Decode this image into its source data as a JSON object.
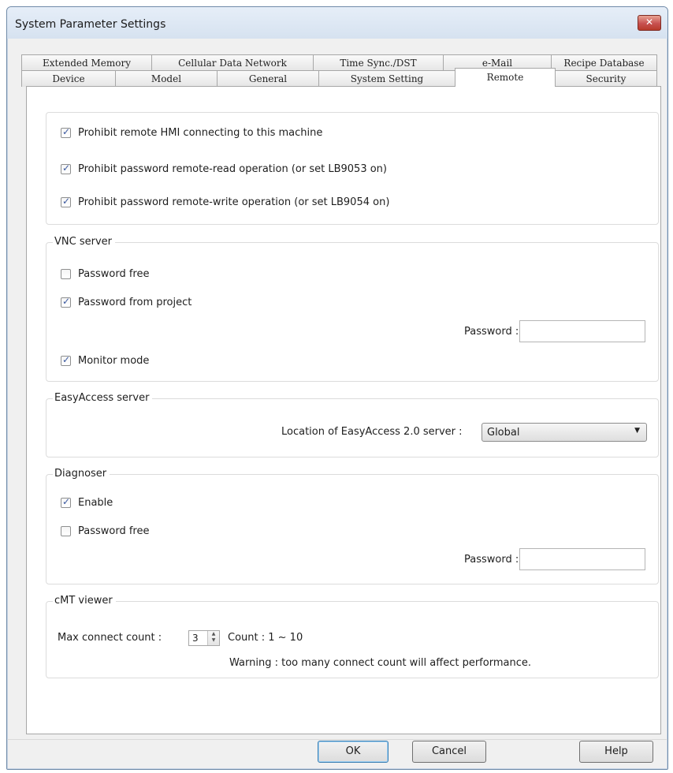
{
  "window": {
    "title": "System Parameter Settings",
    "close_glyph": "✕"
  },
  "tabs": {
    "row1": [
      "Extended Memory",
      "Cellular Data Network",
      "Time Sync./DST",
      "e-Mail",
      "Recipe Database"
    ],
    "row2": [
      "Device",
      "Model",
      "General",
      "System Setting",
      "Remote",
      "Security"
    ],
    "active": "Remote"
  },
  "remote_group": {
    "items": [
      {
        "label": "Prohibit remote HMI connecting to this machine",
        "checked": true
      },
      {
        "label": "Prohibit password remote-read operation (or set LB9053 on)",
        "checked": true
      },
      {
        "label": "Prohibit password remote-write operation (or set LB9054 on)",
        "checked": true
      }
    ]
  },
  "vnc": {
    "title": "VNC server",
    "password_free": {
      "label": "Password free",
      "checked": false
    },
    "password_from_project": {
      "label": "Password from project",
      "checked": true
    },
    "password_label": "Password :",
    "password_value": "",
    "monitor_mode": {
      "label": "Monitor mode",
      "checked": true
    }
  },
  "easyaccess": {
    "title": "EasyAccess server",
    "location_label": "Location of EasyAccess 2.0 server :",
    "location_value": "Global"
  },
  "diagnoser": {
    "title": "Diagnoser",
    "enable": {
      "label": "Enable",
      "checked": true
    },
    "password_free": {
      "label": "Password free",
      "checked": false
    },
    "password_label": "Password :",
    "password_value": ""
  },
  "cmt": {
    "title": "cMT viewer",
    "max_label": "Max connect count :",
    "max_value": "3",
    "count_range": "Count : 1 ~ 10",
    "warning": "Warning : too many connect count will affect performance."
  },
  "buttons": {
    "ok": "OK",
    "cancel": "Cancel",
    "help": "Help"
  }
}
